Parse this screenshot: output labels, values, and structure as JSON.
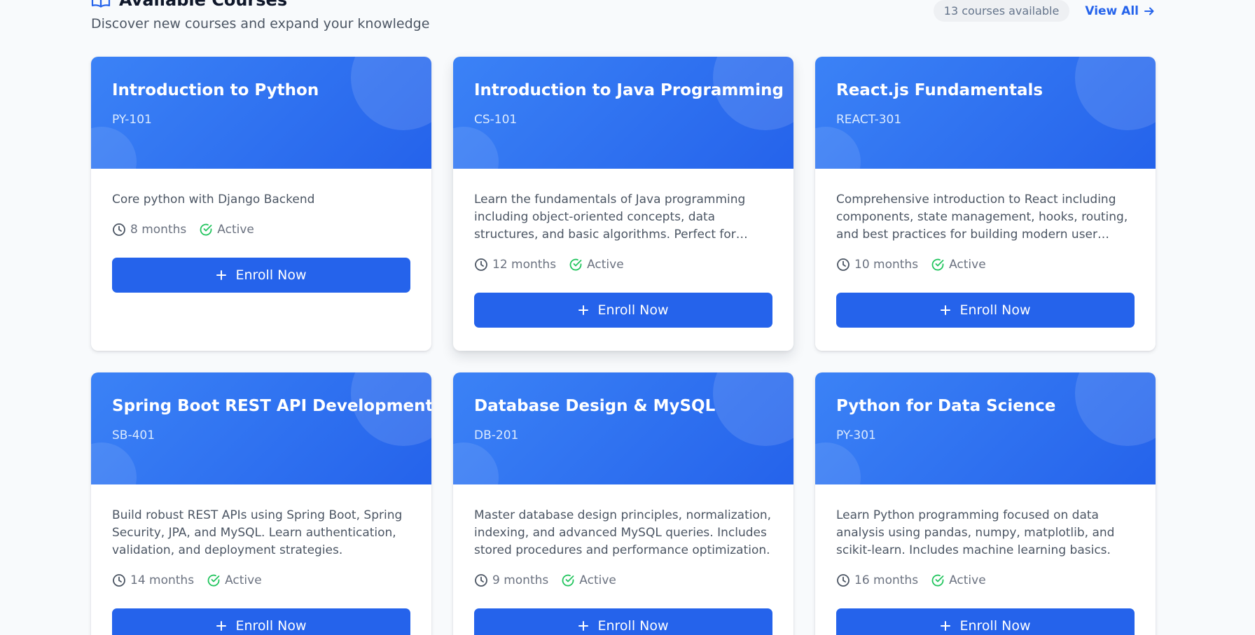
{
  "header": {
    "title": "Available Courses",
    "subtitle": "Discover new courses and expand your knowledge",
    "count_badge": "13 courses available",
    "view_all_label": "View All"
  },
  "colors": {
    "accent": "#2563eb",
    "header_gradient_start": "#3b82f6",
    "status_active": "#22c55e"
  },
  "icons": {
    "title": "book-open-icon",
    "view_all": "arrow-right-icon",
    "duration": "clock-icon",
    "status": "check-circle-icon",
    "enroll": "plus-icon"
  },
  "courses": [
    {
      "title": "Introduction to Python",
      "code": "PY-101",
      "description": "Core python with Django Backend",
      "duration": "8 months",
      "status": "Active",
      "button_label": "Enroll Now"
    },
    {
      "title": "Introduction to Java Programming",
      "code": "CS-101",
      "description": "Learn the fundamentals of Java programming including object-oriented concepts, data structures, and basic algorithms. Perfect for beginners starting...",
      "duration": "12 months",
      "status": "Active",
      "button_label": "Enroll Now"
    },
    {
      "title": "React.js Fundamentals",
      "code": "REACT-301",
      "description": "Comprehensive introduction to React including components, state management, hooks, routing, and best practices for building modern user interfaces.",
      "duration": "10 months",
      "status": "Active",
      "button_label": "Enroll Now"
    },
    {
      "title": "Spring Boot REST API Development",
      "code": "SB-401",
      "description": "Build robust REST APIs using Spring Boot, Spring Security, JPA, and MySQL. Learn authentication, validation, and deployment strategies.",
      "duration": "14 months",
      "status": "Active",
      "button_label": "Enroll Now"
    },
    {
      "title": "Database Design & MySQL",
      "code": "DB-201",
      "description": "Master database design principles, normalization, indexing, and advanced MySQL queries. Includes stored procedures and performance optimization.",
      "duration": "9 months",
      "status": "Active",
      "button_label": "Enroll Now"
    },
    {
      "title": "Python for Data Science",
      "code": "PY-301",
      "description": "Learn Python programming focused on data analysis using pandas, numpy, matplotlib, and scikit-learn. Includes machine learning basics.",
      "duration": "16 months",
      "status": "Active",
      "button_label": "Enroll Now"
    }
  ]
}
